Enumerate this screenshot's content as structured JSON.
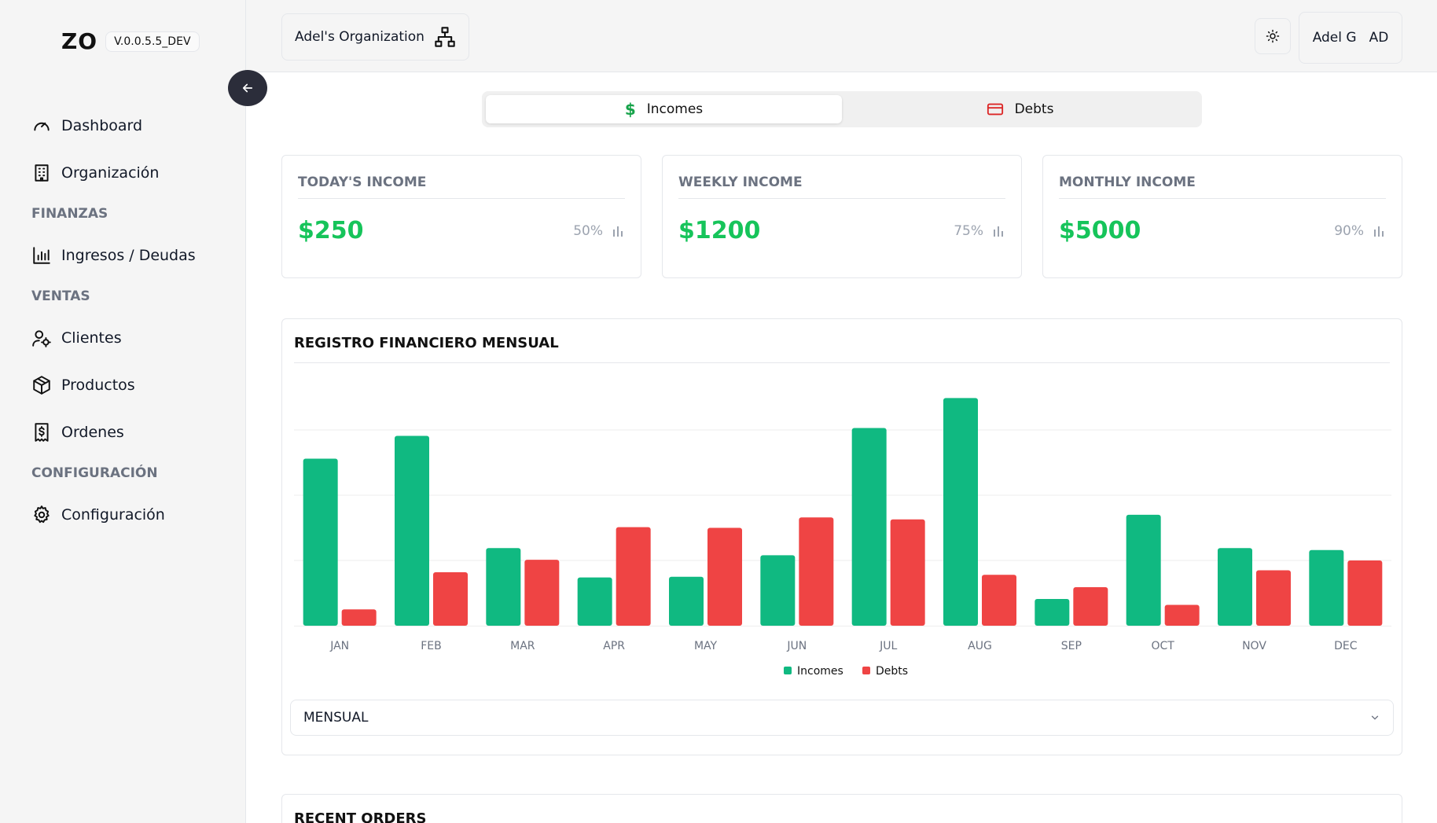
{
  "brand": {
    "logo": "ZO",
    "version": "V.0.0.5.5_DEV"
  },
  "sidebar": {
    "items": [
      {
        "type": "item",
        "label": "Dashboard",
        "icon": "gauge-icon"
      },
      {
        "type": "item",
        "label": "Organización",
        "icon": "building-icon"
      },
      {
        "type": "section",
        "label": "FINANZAS"
      },
      {
        "type": "item",
        "label": "Ingresos / Deudas",
        "icon": "bar-chart-icon"
      },
      {
        "type": "section",
        "label": "VENTAS"
      },
      {
        "type": "item",
        "label": "Clientes",
        "icon": "user-gear-icon"
      },
      {
        "type": "item",
        "label": "Productos",
        "icon": "package-icon"
      },
      {
        "type": "item",
        "label": "Ordenes",
        "icon": "receipt-icon"
      },
      {
        "type": "section",
        "label": "CONFIGURACIÓN"
      },
      {
        "type": "item",
        "label": "Configuración",
        "icon": "gear-icon"
      }
    ]
  },
  "header": {
    "organization": "Adel's Organization",
    "user_name": "Adel G",
    "user_initials": "AD"
  },
  "switcher": {
    "incomes_label": "Incomes",
    "debts_label": "Debts",
    "active": "incomes"
  },
  "stats": [
    {
      "title": "TODAY'S INCOME",
      "value": "$250",
      "percent": "50%"
    },
    {
      "title": "WEEKLY INCOME",
      "value": "$1200",
      "percent": "75%"
    },
    {
      "title": "MONTHLY INCOME",
      "value": "$5000",
      "percent": "90%"
    }
  ],
  "chart_card": {
    "title": "REGISTRO FINANCIERO MENSUAL",
    "period_selected": "MENSUAL"
  },
  "recent_orders": {
    "title": "RECENT ORDERS"
  },
  "colors": {
    "income": "#10b981",
    "debt": "#ef4444",
    "accent_green": "#16c45a"
  },
  "chart_data": {
    "type": "bar",
    "title": "REGISTRO FINANCIERO MENSUAL",
    "categories": [
      "JAN",
      "FEB",
      "MAR",
      "APR",
      "MAY",
      "JUN",
      "JUL",
      "AUG",
      "SEP",
      "OCT",
      "NOV",
      "DEC"
    ],
    "series": [
      {
        "name": "Incomes",
        "color": "#10b981",
        "values": [
          2560,
          2910,
          1190,
          740,
          750,
          1080,
          3030,
          3490,
          410,
          1700,
          1190,
          1160
        ]
      },
      {
        "name": "Debts",
        "color": "#ef4444",
        "values": [
          250,
          820,
          1010,
          1510,
          1500,
          1660,
          1630,
          780,
          590,
          320,
          850,
          1000
        ]
      }
    ],
    "ylim": [
      0,
      4000
    ],
    "grid": true,
    "legend": "bottom-center"
  }
}
